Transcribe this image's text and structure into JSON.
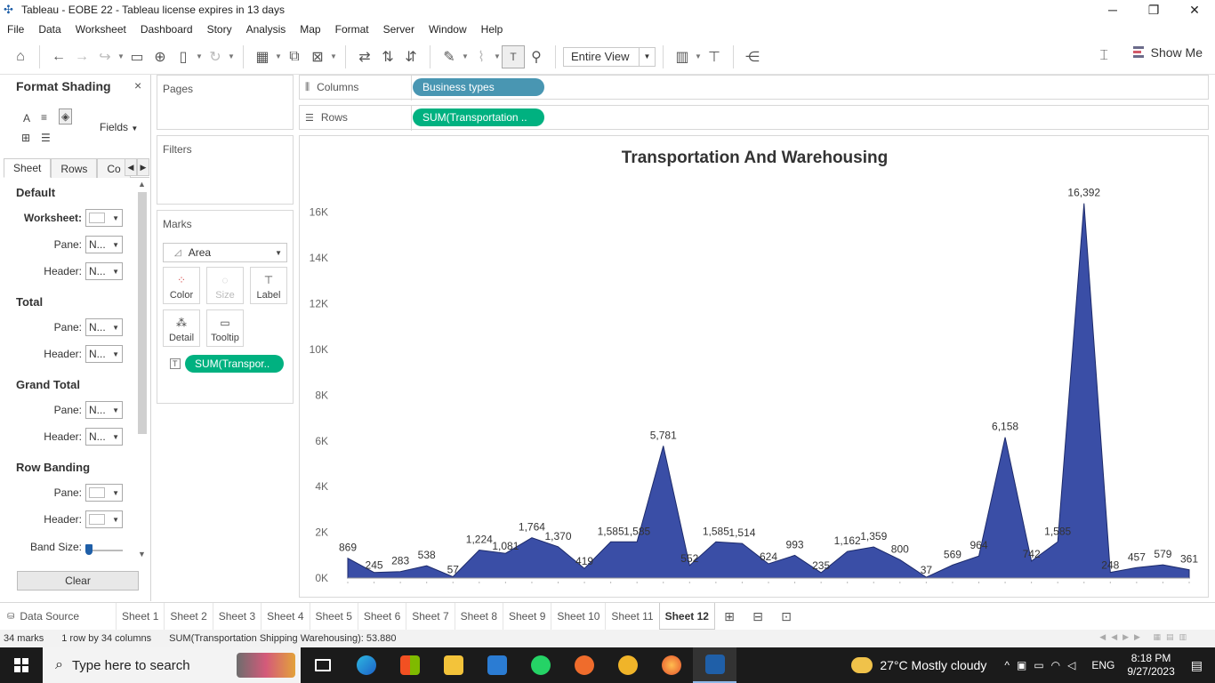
{
  "window": {
    "title": "Tableau - EOBE  22 - Tableau license expires in 13 days",
    "minimize": "─",
    "restore": "❐",
    "close": "✕"
  },
  "menu": [
    "File",
    "Data",
    "Worksheet",
    "Dashboard",
    "Story",
    "Analysis",
    "Map",
    "Format",
    "Server",
    "Window",
    "Help"
  ],
  "toolbar": {
    "view_mode": "Entire View",
    "show_me": "Show Me"
  },
  "format_pane": {
    "title": "Format Shading",
    "close": "×",
    "fields_label": "Fields",
    "tabs": [
      "Sheet",
      "Rows",
      "Co"
    ],
    "sections": {
      "default": "Default",
      "total": "Total",
      "grand_total": "Grand Total",
      "row_banding": "Row Banding"
    },
    "labels": {
      "worksheet": "Worksheet:",
      "pane": "Pane:",
      "header": "Header:",
      "band_size": "Band Size:"
    },
    "none_value": "N...",
    "clear": "Clear"
  },
  "cards": {
    "pages": "Pages",
    "filters": "Filters",
    "marks": "Marks",
    "mark_type": "Area",
    "mark_buttons": [
      "Color",
      "Size",
      "Label",
      "Detail",
      "Tooltip"
    ],
    "label_pill": "SUM(Transpor.."
  },
  "shelves": {
    "columns_label": "Columns",
    "columns_pill": "Business types",
    "rows_label": "Rows",
    "rows_pill": "SUM(Transportation .."
  },
  "chart_data": {
    "type": "area",
    "title": "Transportation And Warehousing",
    "y_ticks": [
      "0K",
      "2K",
      "4K",
      "6K",
      "8K",
      "10K",
      "12K",
      "14K",
      "16K"
    ],
    "ylim": [
      0,
      17000
    ],
    "values": [
      869,
      245,
      283,
      538,
      57,
      1224,
      1081,
      1764,
      1370,
      419,
      1585,
      1585,
      5781,
      552,
      1585,
      1514,
      624,
      993,
      235,
      1162,
      1359,
      800,
      37,
      569,
      964,
      6158,
      742,
      1585,
      16392,
      248,
      457,
      579,
      361
    ],
    "labels": [
      "869",
      "245",
      "283",
      "538",
      "57",
      "1,224",
      "1,081",
      "1,764",
      "1,370",
      "419",
      "1,585",
      "1,585",
      "5,781",
      "552",
      "1,585",
      "1,514",
      "624",
      "993",
      "235",
      "1,162",
      "1,359",
      "800",
      "37",
      "569",
      "964",
      "6,158",
      "742",
      "1,585",
      "16,392",
      "248",
      "457",
      "579",
      "361"
    ],
    "fill_color": "#3a4ea6",
    "line_color": "#1c2a6b",
    "grid": false
  },
  "sheets": {
    "data_source": "Data Source",
    "tabs": [
      "Sheet 1",
      "Sheet 2",
      "Sheet 3",
      "Sheet 4",
      "Sheet 5",
      "Sheet 6",
      "Sheet 7",
      "Sheet 8",
      "Sheet 9",
      "Sheet 10",
      "Sheet 11",
      "Sheet 12"
    ],
    "active": "Sheet 12"
  },
  "status": {
    "marks": "34 marks",
    "dims": "1 row by 34 columns",
    "sum": "SUM(Transportation Shipping Warehousing): 53.880"
  },
  "taskbar": {
    "search_placeholder": "Type here to search",
    "weather": "27°C  Mostly cloudy",
    "lang": "ENG",
    "time": "8:18 PM",
    "date": "9/27/2023"
  }
}
